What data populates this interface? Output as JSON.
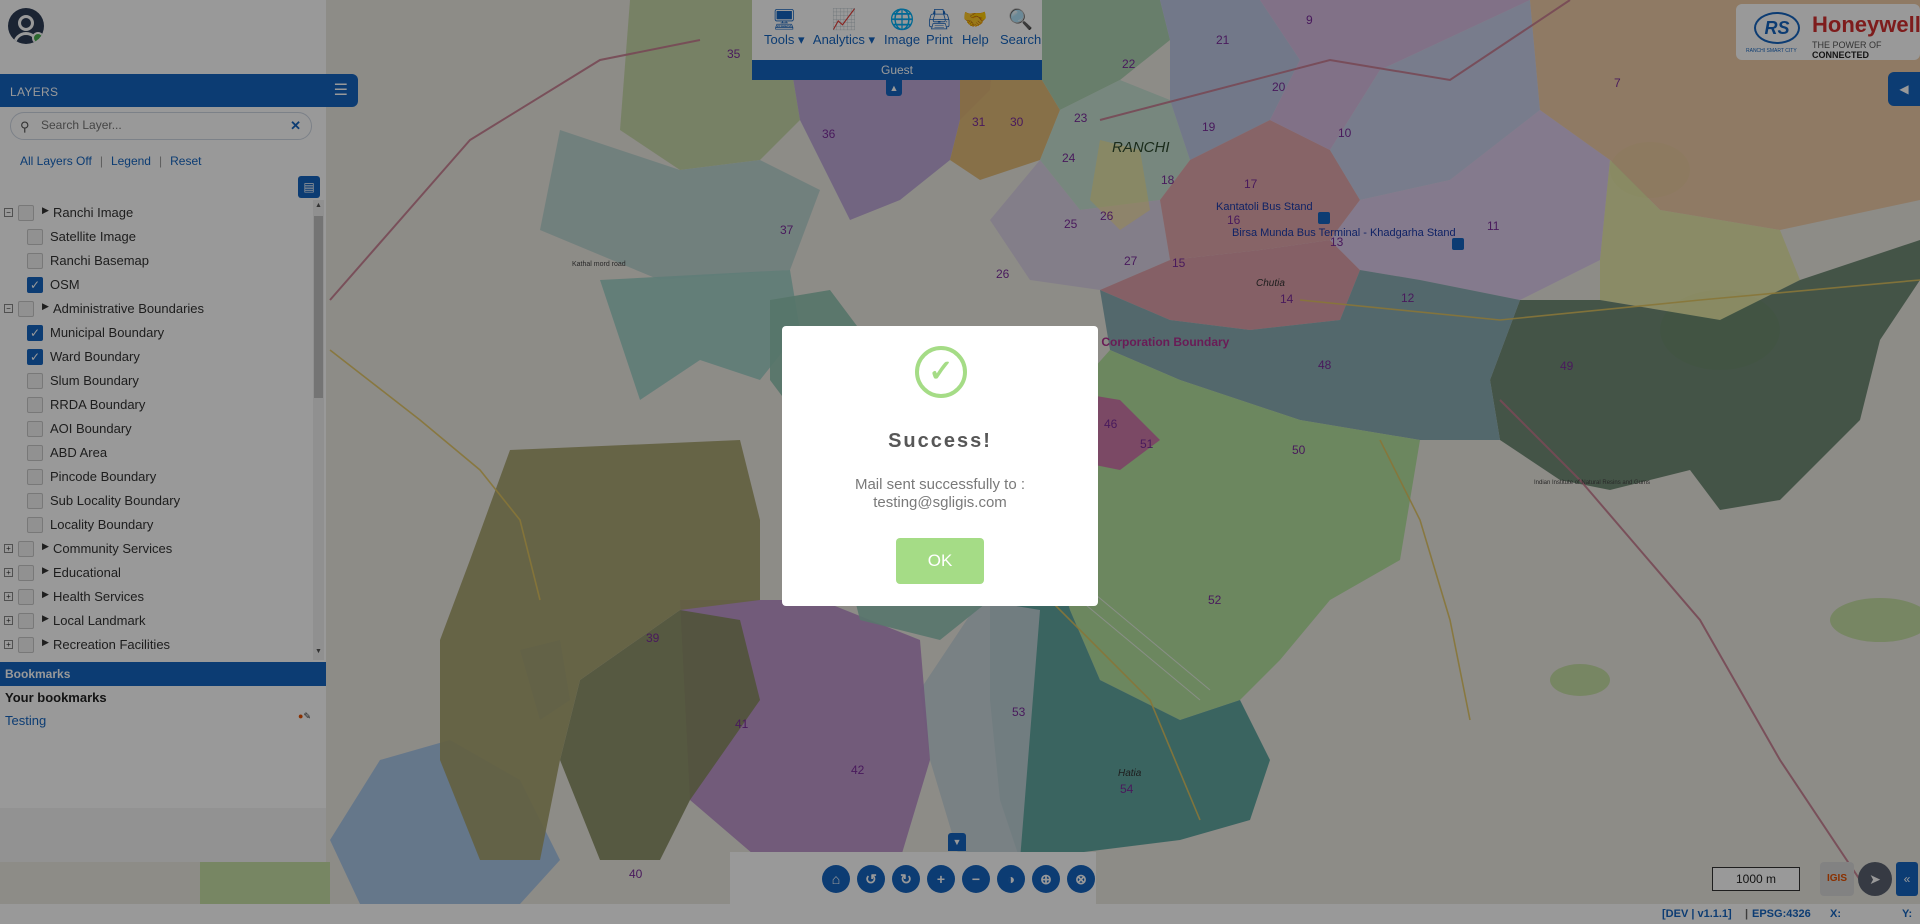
{
  "toolbar": {
    "tools": "Tools",
    "analytics": "Analytics",
    "image": "Image",
    "print": "Print",
    "help": "Help",
    "search": "Search",
    "tools_icon": "monitor-icon",
    "analytics_icon": "chart-line-icon",
    "image_icon": "globe-icon",
    "print_icon": "printer-icon",
    "help_icon": "handshake-icon",
    "search_icon": "search-icon"
  },
  "user": {
    "role": "Guest"
  },
  "brand": {
    "name": "Honeywell",
    "tagline_prefix": "THE POWER OF ",
    "tagline_strong": "CONNECTED",
    "emblem_text": "RANCHI SMART CITY"
  },
  "sidebar": {
    "layers_title": "LAYERS",
    "search_placeholder": "Search Layer...",
    "all_layers_off": "All Layers Off",
    "legend": "Legend",
    "reset": "Reset",
    "tree": [
      {
        "label": "Ranchi Image",
        "group": true,
        "checked": false
      },
      {
        "label": "Satellite Image",
        "group": false,
        "checked": false
      },
      {
        "label": "Ranchi Basemap",
        "group": false,
        "checked": false
      },
      {
        "label": "OSM",
        "group": false,
        "checked": true
      },
      {
        "label": "Administrative Boundaries",
        "group": true,
        "checked": false
      },
      {
        "label": "Municipal Boundary",
        "group": false,
        "checked": true
      },
      {
        "label": "Ward Boundary",
        "group": false,
        "checked": true
      },
      {
        "label": "Slum Boundary",
        "group": false,
        "checked": false
      },
      {
        "label": "RRDA Boundary",
        "group": false,
        "checked": false
      },
      {
        "label": "AOI Boundary",
        "group": false,
        "checked": false
      },
      {
        "label": "ABD Area",
        "group": false,
        "checked": false
      },
      {
        "label": "Pincode Boundary",
        "group": false,
        "checked": false
      },
      {
        "label": "Sub Locality Boundary",
        "group": false,
        "checked": false
      },
      {
        "label": "Locality Boundary",
        "group": false,
        "checked": false
      },
      {
        "label": "Community Services",
        "group": true,
        "checked": false
      },
      {
        "label": "Educational",
        "group": true,
        "checked": false
      },
      {
        "label": "Health Services",
        "group": true,
        "checked": false
      },
      {
        "label": "Local Landmark",
        "group": true,
        "checked": false
      },
      {
        "label": "Recreation Facilities",
        "group": true,
        "checked": false
      }
    ]
  },
  "bookmarks": {
    "header": "Bookmarks",
    "title": "Your bookmarks",
    "items": [
      "Testing"
    ]
  },
  "map": {
    "city_label": "RANCHI",
    "boundary_label": "al Corporation Boundary",
    "bus_stand_1": "Kantatoli Bus Stand",
    "bus_stand_2": "Birsa Munda Bus Terminal - Khadgarha Stand",
    "place_hatia": "Hatia",
    "place_chutia": "Chutia",
    "place_kathal": "Kathal mord road",
    "place_forest": "Indian Institute of Natural Resins and Gums",
    "scale": "1000 m"
  },
  "status": {
    "version": "[DEV | v1.1.1]",
    "epsg": "EPSG:4326",
    "x_label": "X:",
    "y_label": "Y:"
  },
  "dialog": {
    "title": "Success!",
    "message_line1": "Mail sent successfully to :",
    "message_line2": "testing@sgligis.com",
    "ok": "OK",
    "icon": "checkmark-icon"
  },
  "colors": {
    "primary": "#1565c0",
    "success": "#a5dc86",
    "brand_red": "#d32f2f"
  }
}
